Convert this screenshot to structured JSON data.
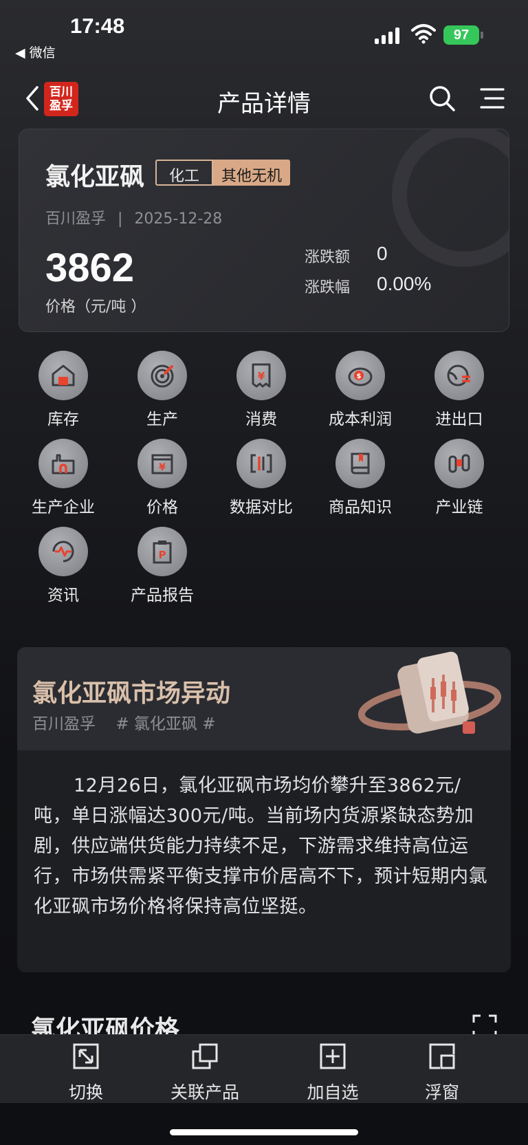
{
  "status_bar": {
    "time": "17:48",
    "back_app": "◀ 微信",
    "battery": "97"
  },
  "nav": {
    "logo_line1": "百川",
    "logo_line2": "盈孚",
    "title": "产品详情"
  },
  "product": {
    "name": "氯化亚砜",
    "tag_industry": "化工",
    "tag_category": "其他无机",
    "source": "百川盈孚",
    "date": "2025-12-28",
    "meta_separator": "|",
    "price": "3862",
    "price_unit": "价格（元/吨 ）",
    "change_amount_label": "涨跌额",
    "change_amount": "0",
    "change_percent_label": "涨跌幅",
    "change_percent": "0.00%"
  },
  "functions": [
    {
      "label": "库存",
      "icon": "warehouse-icon"
    },
    {
      "label": "生产",
      "icon": "target-icon"
    },
    {
      "label": "消费",
      "icon": "receipt-yen-icon"
    },
    {
      "label": "成本利润",
      "icon": "piggy-bank-icon"
    },
    {
      "label": "进出口",
      "icon": "globe-transfer-icon"
    },
    {
      "label": "生产企业",
      "icon": "factory-icon"
    },
    {
      "label": "价格",
      "icon": "price-tag-icon"
    },
    {
      "label": "数据对比",
      "icon": "compare-icon"
    },
    {
      "label": "商品知识",
      "icon": "book-icon"
    },
    {
      "label": "产业链",
      "icon": "chain-icon"
    },
    {
      "label": "资讯",
      "icon": "news-wave-icon"
    },
    {
      "label": "产品报告",
      "icon": "report-icon"
    }
  ],
  "news": {
    "title": "氯化亚砜市场异动",
    "source": "百川盈孚",
    "hashtag": "# 氯化亚砜 #",
    "body": "12月26日，氯化亚砜市场均价攀升至3862元/吨，单日涨幅达300元/吨。当前场内货源紧缺态势加剧，供应端供货能力持续不足，下游需求维持高位运行，市场供需紧平衡支撑市价居高不下，预计短期内氯化亚砜市场价格将保持高位坚挺。"
  },
  "price_section": {
    "title": "氯化亚砜价格"
  },
  "bottom_bar": [
    {
      "label": "切换",
      "icon": "switch-icon"
    },
    {
      "label": "关联产品",
      "icon": "related-products-icon"
    },
    {
      "label": "加自选",
      "icon": "add-favorite-icon"
    },
    {
      "label": "浮窗",
      "icon": "float-window-icon"
    }
  ],
  "colors": {
    "accent_gold": "#d9a987",
    "logo_red": "#d2261d",
    "icon_red": "#e8432f",
    "battery_green": "#35c759"
  }
}
